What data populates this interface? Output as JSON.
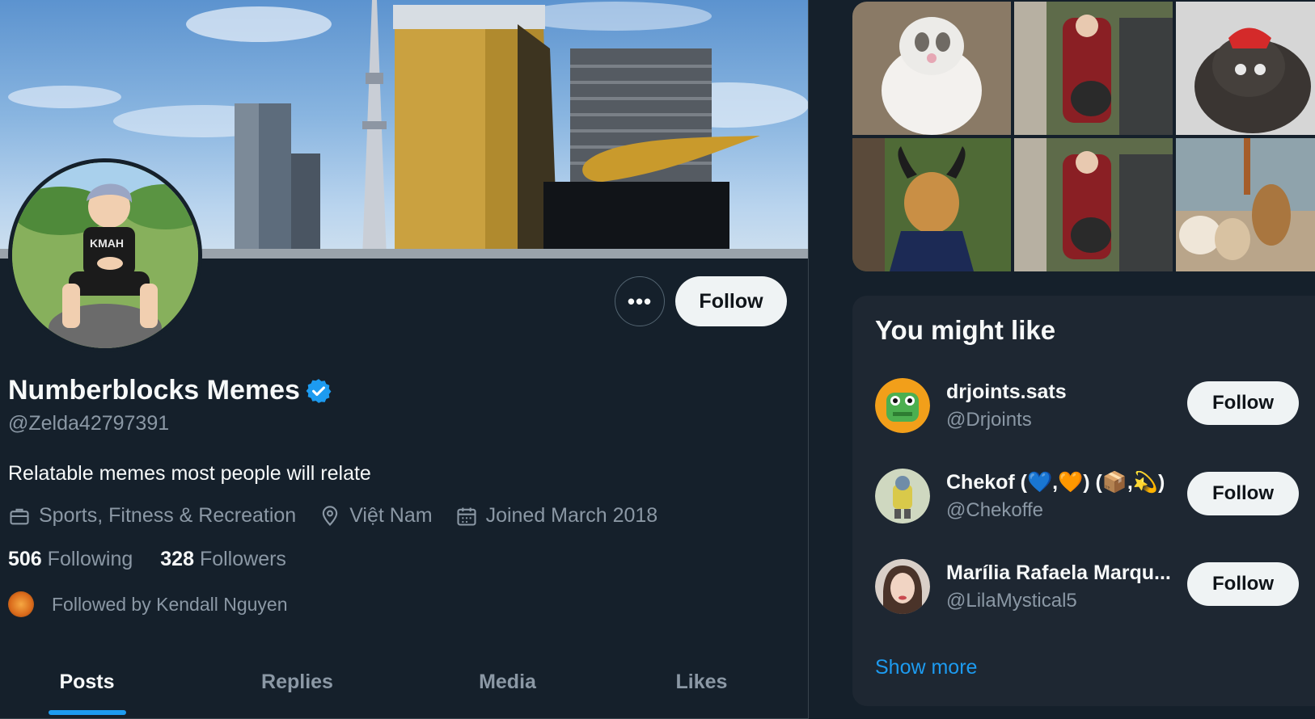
{
  "profile": {
    "display_name": "Numberblocks Memes",
    "handle": "@Zelda42797391",
    "bio": "Relatable memes most people will relate",
    "category": "Sports, Fitness & Recreation",
    "location": "Việt Nam",
    "joined": "Joined March 2018",
    "following_count": "506",
    "following_label": "Following",
    "followers_count": "328",
    "followers_label": "Followers",
    "followed_by": "Followed by Kendall Nguyen",
    "more_icon": "more-horizontal-icon",
    "follow_label": "Follow"
  },
  "tabs": [
    {
      "label": "Posts",
      "active": true
    },
    {
      "label": "Replies",
      "active": false
    },
    {
      "label": "Media",
      "active": false
    },
    {
      "label": "Likes",
      "active": false
    }
  ],
  "you_might_like": {
    "title": "You might like",
    "suggestions": [
      {
        "name": "drjoints.sats",
        "handle": "@Drjoints",
        "follow_label": "Follow"
      },
      {
        "name": "Chekof (💙,🧡) (📦,💫)",
        "handle": "@Chekoffe",
        "follow_label": "Follow"
      },
      {
        "name": "Marília Rafaela Marqu...",
        "handle": "@LilaMystical5",
        "follow_label": "Follow"
      }
    ],
    "show_more": "Show more"
  },
  "colors": {
    "background": "#15202b",
    "accent": "#1d9bf0",
    "secondary_text": "#8b98a5",
    "card": "#1e2732"
  }
}
